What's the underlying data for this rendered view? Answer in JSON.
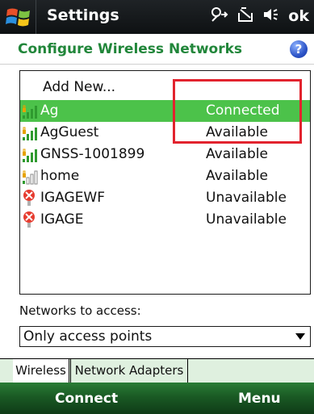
{
  "titlebar": {
    "title": "Settings",
    "status_icons": [
      "connectivity-icon",
      "battery-icon",
      "volume-icon"
    ],
    "ok_label": "ok"
  },
  "header": {
    "title": "Configure Wireless Networks",
    "help_label": "?"
  },
  "networks": {
    "add_new_label": "Add New...",
    "items": [
      {
        "name": "Ag",
        "status": "Connected",
        "signal_icon": "wifi-signal-icon",
        "selected": true
      },
      {
        "name": "AgGuest",
        "status": "Available",
        "signal_icon": "wifi-signal-icon",
        "selected": false
      },
      {
        "name": "GNSS-1001899",
        "status": "Available",
        "signal_icon": "wifi-signal-icon",
        "selected": false
      },
      {
        "name": "home",
        "status": "Available",
        "signal_icon": "wifi-weak-signal-icon",
        "selected": false
      },
      {
        "name": "IGAGEWF",
        "status": "Unavailable",
        "signal_icon": "wifi-unavailable-icon",
        "selected": false
      },
      {
        "name": "IGAGE",
        "status": "Unavailable",
        "signal_icon": "wifi-unavailable-icon",
        "selected": false
      }
    ]
  },
  "access": {
    "label": "Networks to access:",
    "selected": "Only access points"
  },
  "tabs": [
    {
      "label": "Wireless",
      "active": true
    },
    {
      "label": "Network Adapters",
      "active": false
    }
  ],
  "softkeys": {
    "left": "Connect",
    "right": "Menu"
  },
  "colors": {
    "accent_green": "#21863a",
    "selection_green": "#4cc24a",
    "highlight_red": "#e2232e"
  }
}
